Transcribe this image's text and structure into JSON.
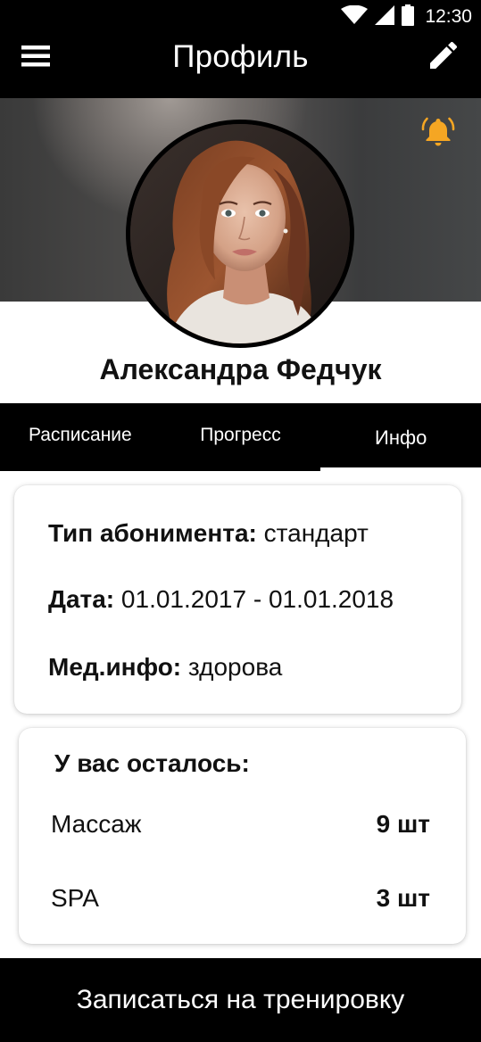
{
  "status_bar": {
    "time": "12:30"
  },
  "app_bar": {
    "title": "Профиль"
  },
  "profile": {
    "name": "Александра Федчук"
  },
  "tabs": [
    {
      "label": "Расписание",
      "active": false
    },
    {
      "label": "Прогресс",
      "active": false
    },
    {
      "label": "Инфо",
      "active": true
    }
  ],
  "info": {
    "subscription_label": "Тип абонимента:",
    "subscription_value": "стандарт",
    "date_label": "Дата:",
    "date_value": "01.01.2017 - 01.01.2018",
    "med_label": "Мед.инфо:",
    "med_value": "здорова"
  },
  "remaining": {
    "title": "У вас осталось:",
    "items": [
      {
        "name": "Массаж",
        "qty": "9 шт"
      },
      {
        "name": "SPA",
        "qty": "3 шт"
      }
    ]
  },
  "cta": {
    "label": "Записаться на тренировку"
  },
  "colors": {
    "bar_background": "#000000",
    "bell_accent": "#f5a623",
    "text_primary": "#111111"
  },
  "icons": [
    "wifi-icon",
    "signal-icon",
    "battery-icon",
    "hamburger-menu-icon",
    "pencil-edit-icon",
    "bell-icon"
  ]
}
